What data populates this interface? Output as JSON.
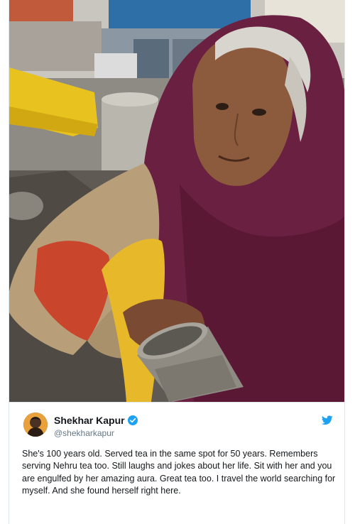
{
  "tweet": {
    "author_name": "Shekhar Kapur",
    "handle": "@shekharkapur",
    "text": "She's 100 years old. Served tea in the same spot for 50 years. Remembers serving Nehru tea too. Still laughs and jokes about her life. Sit with her and you are engulfed by her amazing aura. Great tea too. I travel the world searching for myself. And she found herself right here."
  },
  "photo": {
    "description_icon": "photo-elderly-tea-seller"
  },
  "icons": {
    "verified": "verified-badge-icon",
    "platform": "twitter-bird-icon"
  },
  "colors": {
    "accent": "#1da1f2",
    "text": "#14171a",
    "muted": "#657786"
  }
}
